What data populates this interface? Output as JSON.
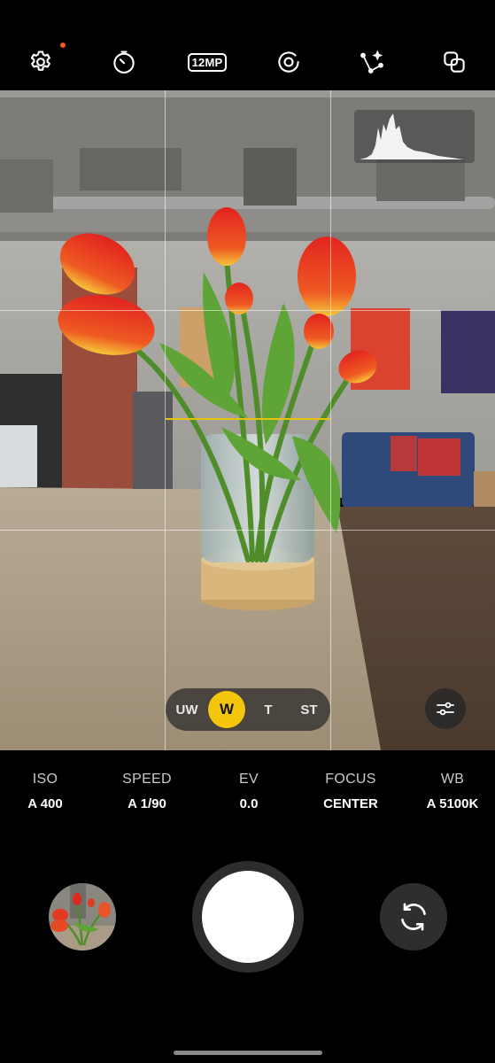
{
  "toolbar": {
    "resolution_label": "12MP",
    "icons": [
      "gear-icon",
      "timer-icon",
      "resolution-badge",
      "motion-photo-icon",
      "filters-icon",
      "aspect-icon"
    ],
    "notification_dot_color": "#f05a28"
  },
  "zoom": {
    "options": [
      "UW",
      "W",
      "T",
      "ST"
    ],
    "selected": "W",
    "accent_color": "#f4c60b"
  },
  "pro_controls": [
    {
      "label": "ISO",
      "value": "A 400"
    },
    {
      "label": "SPEED",
      "value": "A 1/90"
    },
    {
      "label": "EV",
      "value": "0.0"
    },
    {
      "label": "FOCUS",
      "value": "CENTER"
    },
    {
      "label": "WB",
      "value": "A 5100K"
    }
  ],
  "level_indicator_color": "#e6c20b"
}
